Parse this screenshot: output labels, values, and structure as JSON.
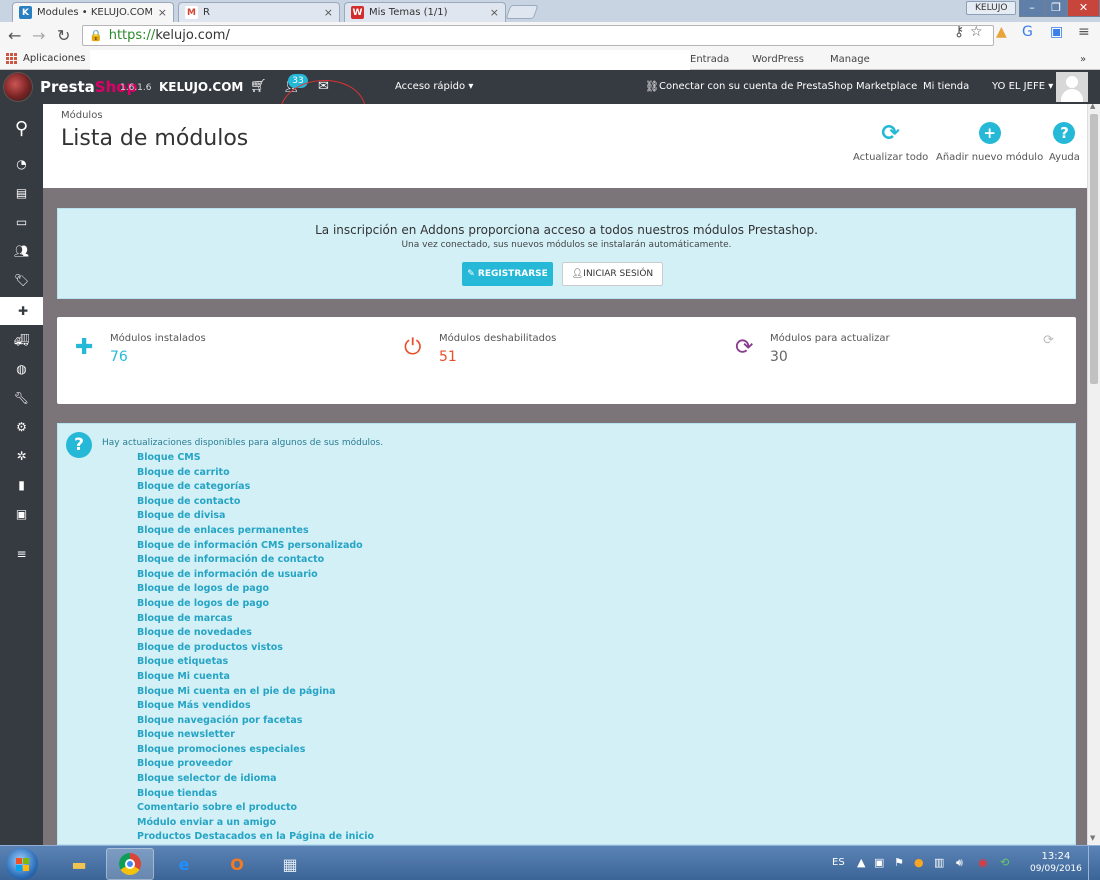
{
  "browser": {
    "tabs": [
      {
        "title": "Modules • KELUJO.COM",
        "fav": "K",
        "fav_color": "#2a7fc1"
      },
      {
        "title": "R",
        "fav": "M",
        "fav_color": "#d14836"
      },
      {
        "title": "Mis Temas (1/1)",
        "fav": "W",
        "fav_color": "#d22c2c"
      }
    ],
    "close_glyph": "×",
    "profile": "KELUJO",
    "url_scheme": "https://",
    "url_host": "kelujo.com/",
    "bookmarks": {
      "apps": "Aplicaciones",
      "items": [
        "Entrada",
        "WordPress",
        "Manage"
      ]
    }
  },
  "header": {
    "logo_presta": "Presta",
    "logo_shop": "Shop",
    "version": "1.6.1.6",
    "shop_name": "KELUJO.COM",
    "badge_count": "33",
    "quick_access": "Acceso rápido ▾",
    "connect": "Conectar con su cuenta de PrestaShop Marketplace",
    "my_shop": "Mi tienda",
    "user": "YO EL JEFE ▾"
  },
  "toolbar": {
    "breadcrumb": "Módulos",
    "title": "Lista de módulos",
    "buttons": {
      "refresh": "Actualizar todo",
      "add": "Añadir nuevo módulo",
      "help": "Ayuda"
    }
  },
  "addons": {
    "message": "La inscripción en Addons proporciona acceso a todos nuestros módulos Prestashop.",
    "submessage": "Una vez conectado, sus nuevos módulos se instalarán automáticamente.",
    "register": "REGISTRARSE",
    "login": "INICIAR SESIÓN"
  },
  "stats": {
    "installed": {
      "label": "Módulos instalados",
      "value": "76",
      "color": "#25b9d7"
    },
    "disabled": {
      "label": "Módulos deshabilitados",
      "value": "51",
      "color": "#e84e28"
    },
    "to_update": {
      "label": "Módulos para actualizar",
      "value": "30",
      "color": "#8a3a8f"
    }
  },
  "updates": {
    "intro": "Hay actualizaciones disponibles para algunos de sus módulos.",
    "modules": [
      "Bloque CMS",
      "Bloque de carrito",
      "Bloque de categorías",
      "Bloque de contacto",
      "Bloque de divisa",
      "Bloque de enlaces permanentes",
      "Bloque de información CMS personalizado",
      "Bloque de información de contacto",
      "Bloque de información de usuario",
      "Bloque de logos de pago",
      "Bloque de logos de pago",
      "Bloque de marcas",
      "Bloque de novedades",
      "Bloque de productos vistos",
      "Bloque etiquetas",
      "Bloque Mi cuenta",
      "Bloque Mi cuenta en el pie de página",
      "Bloque Más vendidos",
      "Bloque navegación por facetas",
      "Bloque newsletter",
      "Bloque promociones especiales",
      "Bloque proveedor",
      "Bloque selector de idioma",
      "Bloque tiendas",
      "Comentario sobre el producto",
      "Módulo enviar a un amigo",
      "Productos Destacados en la Página de inicio"
    ]
  },
  "taskbar": {
    "language": "ES",
    "time": "13:24",
    "date": "09/09/2016"
  }
}
